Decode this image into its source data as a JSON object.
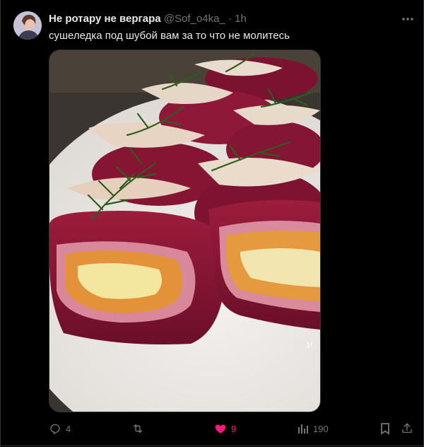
{
  "tweet": {
    "author_name": "Не ротару не вергара",
    "author_handle": "@Sof_o4ka_",
    "separator": "·",
    "time": "1h",
    "text": "сушеледка под шубой вам за то что не молитесь",
    "media_overlay": "1!"
  },
  "actions": {
    "replies": "4",
    "likes": "9",
    "views": "190"
  },
  "colors": {
    "background": "#000000",
    "text": "#e7e9ea",
    "muted": "#71767b",
    "like": "#f91880"
  },
  "icons": [
    "more-icon",
    "reply-icon",
    "retweet-icon",
    "like-icon",
    "views-icon",
    "bookmark-icon",
    "share-icon"
  ]
}
